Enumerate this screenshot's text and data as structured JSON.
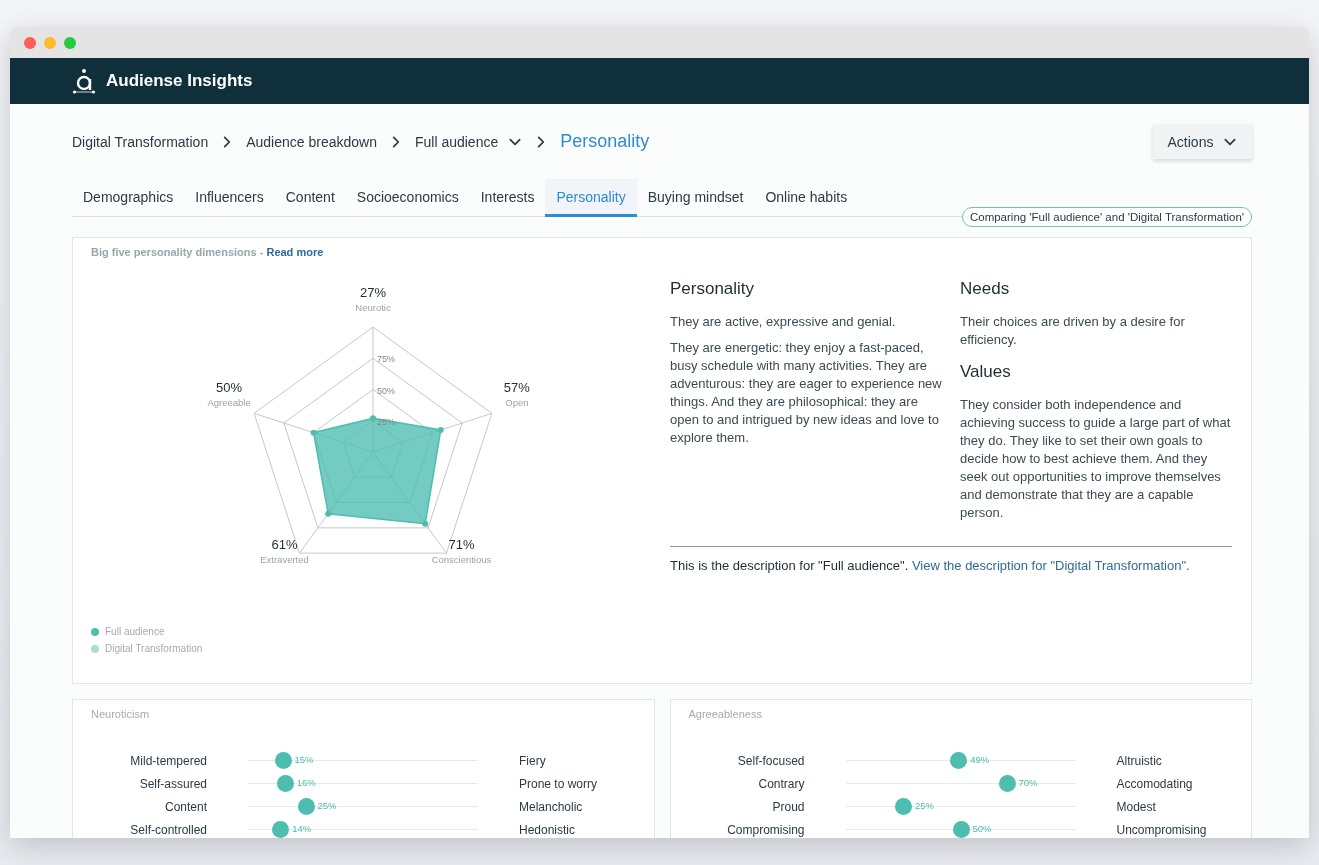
{
  "header": {
    "title": "Audiense Insights"
  },
  "breadcrumb": [
    {
      "label": "Digital Transformation",
      "kind": "link"
    },
    {
      "label": "Audience breakdown",
      "kind": "link"
    },
    {
      "label": "Full audience",
      "kind": "dropdown"
    },
    {
      "label": "Personality",
      "kind": "current"
    }
  ],
  "actions_button": "Actions",
  "tabs": [
    {
      "label": "Demographics",
      "selected": false
    },
    {
      "label": "Influencers",
      "selected": false
    },
    {
      "label": "Content",
      "selected": false
    },
    {
      "label": "Socioeconomics",
      "selected": false
    },
    {
      "label": "Interests",
      "selected": false
    },
    {
      "label": "Personality",
      "selected": true
    },
    {
      "label": "Buying mindset",
      "selected": false
    },
    {
      "label": "Online habits",
      "selected": false
    }
  ],
  "comparison_badge": "Comparing 'Full audience' and 'Digital Transformation'",
  "big_five": {
    "title": "Big five personality dimensions - ",
    "link": "Read more",
    "rings": [
      "75%",
      "50%",
      "25%"
    ],
    "axes": [
      {
        "label": "Neurotic",
        "value": "27%"
      },
      {
        "label": "Agreeable",
        "value": "50%"
      },
      {
        "label": "Open",
        "value": "57%"
      },
      {
        "label": "Extraverted",
        "value": "61%"
      },
      {
        "label": "Conscientious",
        "value": "71%"
      }
    ],
    "legend": [
      {
        "label": "Full audience",
        "color": "#4dbdb0"
      },
      {
        "label": "Digital Transformation",
        "color": "#a9ddd6"
      }
    ],
    "columns": [
      [
        {
          "heading": "Personality",
          "paragraphs": [
            "They are active, expressive and genial.",
            "They are energetic: they enjoy a fast-paced, busy schedule with many activities. They are adventurous: they are eager to experience new things. And they are philosophical: they are open to and intrigued by new ideas and love to explore them."
          ]
        }
      ],
      [
        {
          "heading": "Needs",
          "paragraphs": [
            "Their choices are driven by a desire for efficiency."
          ]
        },
        {
          "heading": "Values",
          "paragraphs": [
            "They consider both independence and achieving success to guide a large part of what they do. They like to set their own goals to decide how to best achieve them. And they seek out opportunities to improve themselves and demonstrate that they are a capable person."
          ]
        }
      ]
    ],
    "footer": {
      "text": "This is the description for \"Full audience\".",
      "link": "View the description for \"Digital Transformation\"."
    }
  },
  "trait_panels": [
    {
      "title": "Neuroticism",
      "rows": [
        {
          "left": "Mild-tempered",
          "right": "Fiery",
          "reading": "15%",
          "level": 0.15
        },
        {
          "left": "Self-assured",
          "right": "Prone to worry",
          "reading": "16%",
          "level": 0.16
        },
        {
          "left": "Content",
          "right": "Melancholic",
          "reading": "25%",
          "level": 0.25
        },
        {
          "left": "Self-controlled",
          "right": "Hedonistic",
          "reading": "14%",
          "level": 0.14
        }
      ]
    },
    {
      "title": "Agreeableness",
      "rows": [
        {
          "left": "Self-focused",
          "right": "Altruistic",
          "reading": "49%",
          "level": 0.49
        },
        {
          "left": "Contrary",
          "right": "Accomodating",
          "reading": "70%",
          "level": 0.7
        },
        {
          "left": "Proud",
          "right": "Modest",
          "reading": "25%",
          "level": 0.25
        },
        {
          "left": "Compromising",
          "right": "Uncompromising",
          "reading": "50%",
          "level": 0.5
        }
      ]
    }
  ]
}
